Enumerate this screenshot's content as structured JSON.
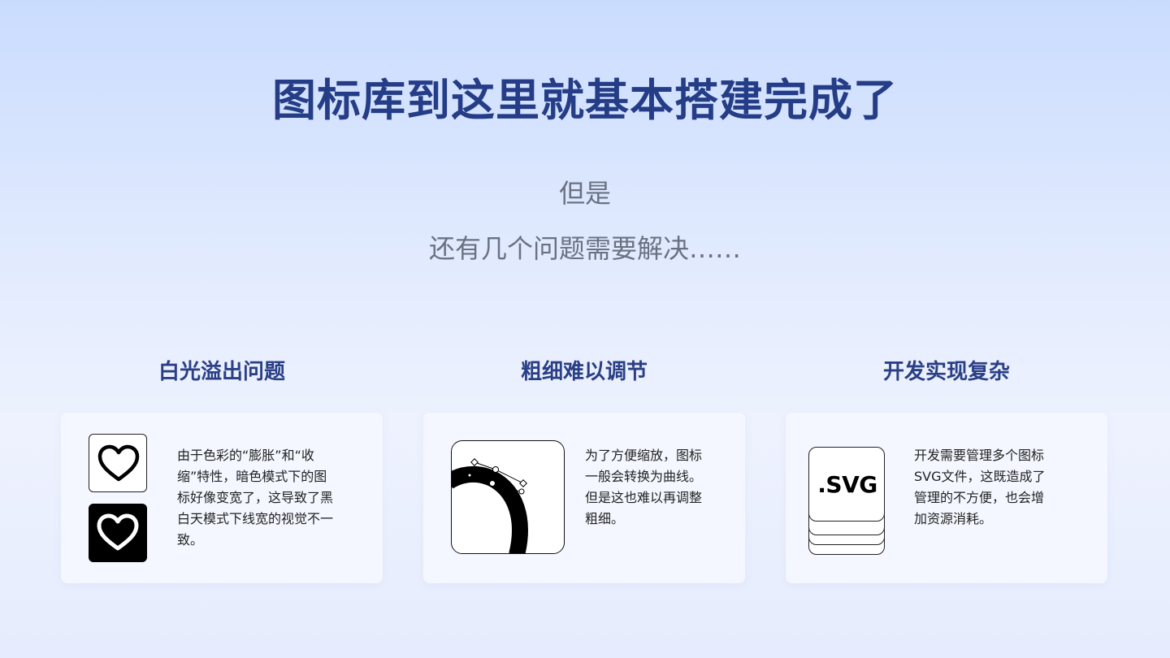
{
  "title": "图标库到这里就基本搭建完成了",
  "subtitle_line1": "但是",
  "subtitle_line2": "还有几个问题需要解决……",
  "columns": [
    {
      "title": "白光溢出问题",
      "text_lines": [
        "由于色彩的“膨胀”和“收",
        "缩”特性，暗色模式下的图",
        "标好像变宽了，这导致了黑",
        "白天模式下线宽的视觉不一",
        "致。"
      ],
      "icons": [
        "heart-outline-light-icon",
        "heart-outline-dark-icon"
      ]
    },
    {
      "title": "粗细难以调节",
      "text_lines": [
        "为了方便缩放，图标",
        "一般会转换为曲线。",
        "但是这也难以再调整",
        "粗细。"
      ],
      "icons": [
        "bezier-curve-icon"
      ]
    },
    {
      "title": "开发实现复杂",
      "text_lines": [
        "开发需要管理多个图标",
        "SVG文件，这既造成了",
        "管理的不方便，也会增",
        "加资源消耗。"
      ],
      "icons": [
        "svg-file-stack-icon"
      ],
      "file_label": ".SVG"
    }
  ],
  "colors": {
    "title": "#243d86",
    "column_title": "#2a3f85",
    "subtitle": "#6a7282",
    "card_bg": "#f4f7ff"
  }
}
